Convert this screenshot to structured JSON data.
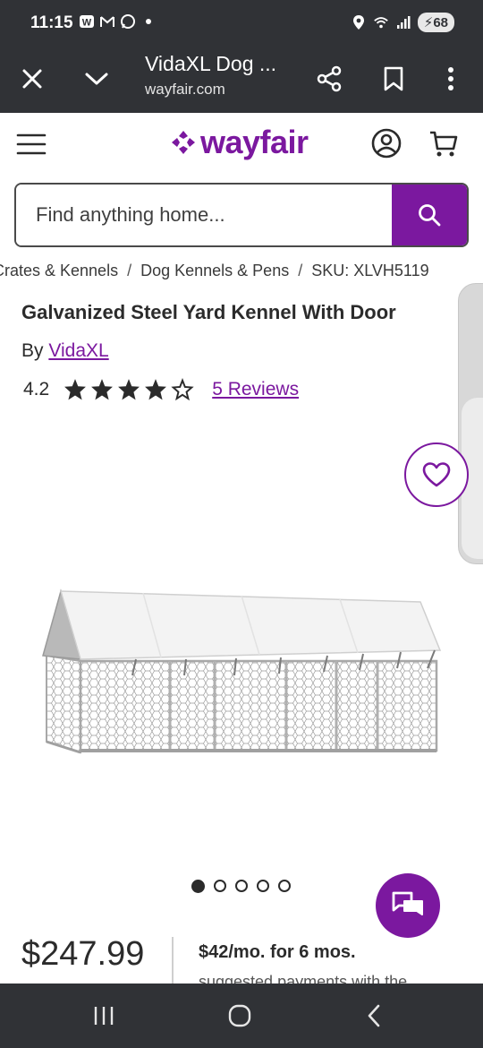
{
  "status_bar": {
    "time": "11:15",
    "battery": "68",
    "left_icons": [
      "wayfair-notification-icon",
      "mail-icon",
      "whatsapp-icon",
      "dot-icon"
    ],
    "right_icons": [
      "location-icon",
      "wifi-icon",
      "signal-icon",
      "battery-icon"
    ]
  },
  "browser": {
    "page_title": "VidaXL Dog ...",
    "url": "wayfair.com"
  },
  "header": {
    "logo_text": "wayfair",
    "brand_color": "#7b189f"
  },
  "search": {
    "placeholder": "Find anything home..."
  },
  "breadcrumb": {
    "items": [
      "Crates & Kennels",
      "Dog Kennels & Pens",
      "SKU: XLVH5119"
    ],
    "separator": "/"
  },
  "product": {
    "title": "Galvanized Steel Yard Kennel With Door",
    "by_prefix": "By",
    "brand": "VidaXL",
    "rating": "4.2",
    "stars_filled": 4,
    "stars_total": 5,
    "reviews_label": "5 Reviews",
    "image_count": 5,
    "active_image": 1
  },
  "pricing": {
    "price": "$247.99",
    "financing": "$42/mo. for 6 mos.",
    "financing_sub": "suggested payments with the"
  }
}
